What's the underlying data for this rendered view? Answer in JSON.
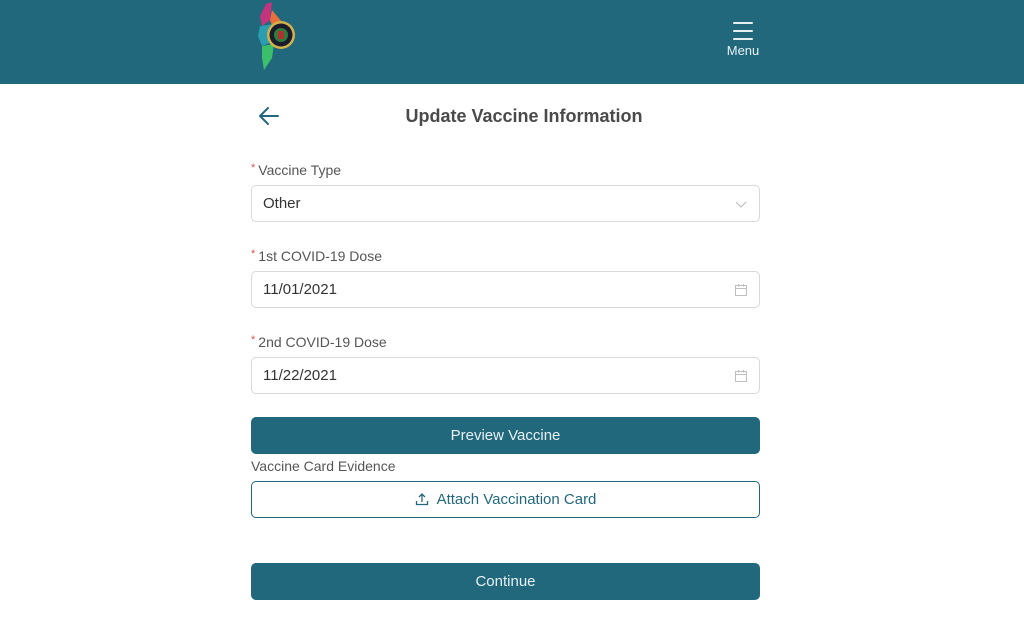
{
  "header": {
    "logo_icon": "government-seal-logo",
    "menu_icon": "hamburger-menu-icon",
    "menu_label": "Menu"
  },
  "page": {
    "back_icon": "arrow-left-icon",
    "title": "Update Vaccine Information"
  },
  "form": {
    "required_marker": "*",
    "vaccine_type": {
      "label": "Vaccine Type",
      "value": "Other",
      "icon": "chevron-down-icon"
    },
    "first_dose": {
      "label": "1st COVID-19 Dose",
      "value": "11/01/2021",
      "icon": "calendar-icon"
    },
    "second_dose": {
      "label": "2nd COVID-19 Dose",
      "value": "11/22/2021",
      "icon": "calendar-icon"
    },
    "preview_button": "Preview Vaccine",
    "evidence_label": "Vaccine Card Evidence",
    "attach_button": "Attach Vaccination Card",
    "attach_icon": "upload-icon",
    "continue_button": "Continue"
  },
  "colors": {
    "brand": "#22687d",
    "required": "#e24b4b",
    "title_text": "#4a4a4a"
  }
}
